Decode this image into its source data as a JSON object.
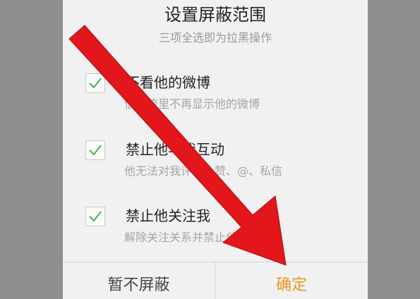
{
  "dialog": {
    "title": "设置屏蔽范围",
    "subtitle": "三项全选即为拉黑操作",
    "options": [
      {
        "label": "不看他的微博",
        "description": "信息流里不再显示他的微博",
        "checked": true
      },
      {
        "label": "禁止他与我互动",
        "description": "他无法对我评论、赞、@、私信",
        "checked": true
      },
      {
        "label": "禁止他关注我",
        "description": "解除关注关系并禁止他关注我",
        "checked": true
      }
    ],
    "cancel_label": "暂不屏蔽",
    "confirm_label": "确定"
  },
  "colors": {
    "backdrop": "#8e8e8e",
    "dialog_bg": "#f1f1f1",
    "checkmark": "#4caf50",
    "confirm_text": "#f0951c",
    "annotation_arrow": "#e3161b"
  },
  "annotation": {
    "icon": "red-arrow-icon",
    "points_to": "confirm-button"
  }
}
